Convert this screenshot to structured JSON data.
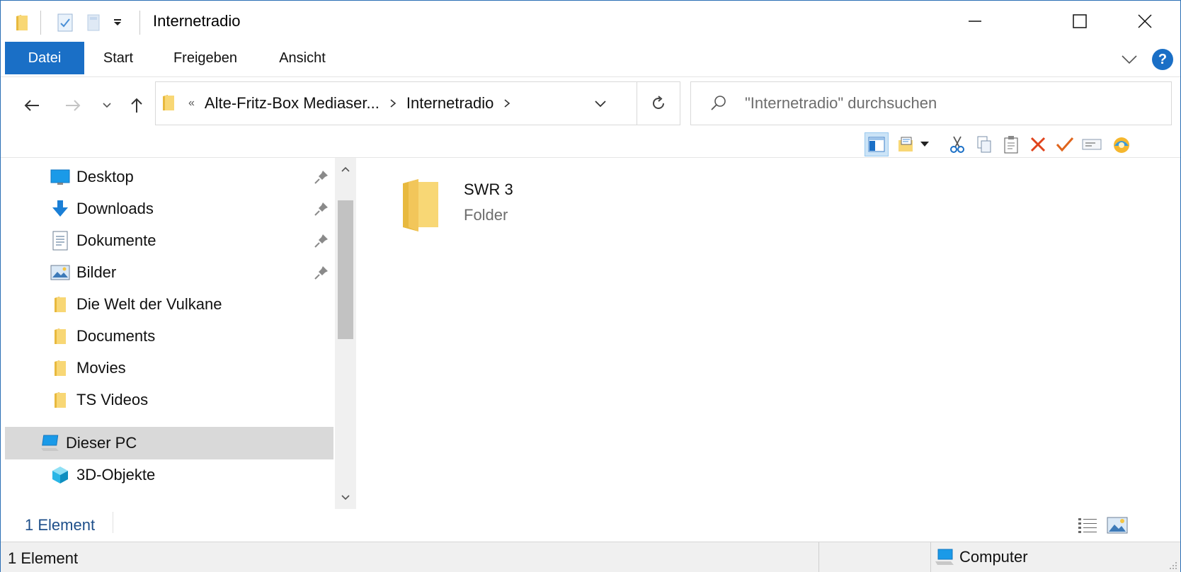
{
  "window": {
    "title": "Internetradio"
  },
  "ribbon": {
    "tabs": [
      {
        "label": "Datei"
      },
      {
        "label": "Start"
      },
      {
        "label": "Freigeben"
      },
      {
        "label": "Ansicht"
      }
    ],
    "help_label": "?"
  },
  "address": {
    "overflow_marker": "«",
    "crumbs": [
      "Alte-Fritz-Box Mediaser...",
      "Internetradio"
    ]
  },
  "search": {
    "placeholder": "\"Internetradio\" durchsuchen"
  },
  "navpane": {
    "items": [
      {
        "label": "Desktop",
        "icon": "desktop-icon",
        "pinned": true
      },
      {
        "label": "Downloads",
        "icon": "download-arrow-icon",
        "pinned": true
      },
      {
        "label": "Dokumente",
        "icon": "document-icon",
        "pinned": true
      },
      {
        "label": "Bilder",
        "icon": "pictures-icon",
        "pinned": true
      },
      {
        "label": "Die Welt der Vulkane",
        "icon": "folder-icon",
        "pinned": false
      },
      {
        "label": "Documents",
        "icon": "folder-icon",
        "pinned": false
      },
      {
        "label": "Movies",
        "icon": "folder-icon",
        "pinned": false
      },
      {
        "label": "TS Videos",
        "icon": "folder-icon",
        "pinned": false
      },
      {
        "label": "Dieser PC",
        "icon": "computer-icon",
        "pinned": false,
        "selected": true
      },
      {
        "label": "3D-Objekte",
        "icon": "cube-3d-icon",
        "pinned": false
      }
    ]
  },
  "content": {
    "items": [
      {
        "name": "SWR 3",
        "type": "Folder"
      }
    ]
  },
  "status": {
    "inner_count": "1 Element",
    "bottom_count": "1 Element",
    "location": "Computer"
  },
  "colors": {
    "accent": "#1a6fc6",
    "folder": "#f8d775",
    "selection": "#d9d9d9"
  }
}
